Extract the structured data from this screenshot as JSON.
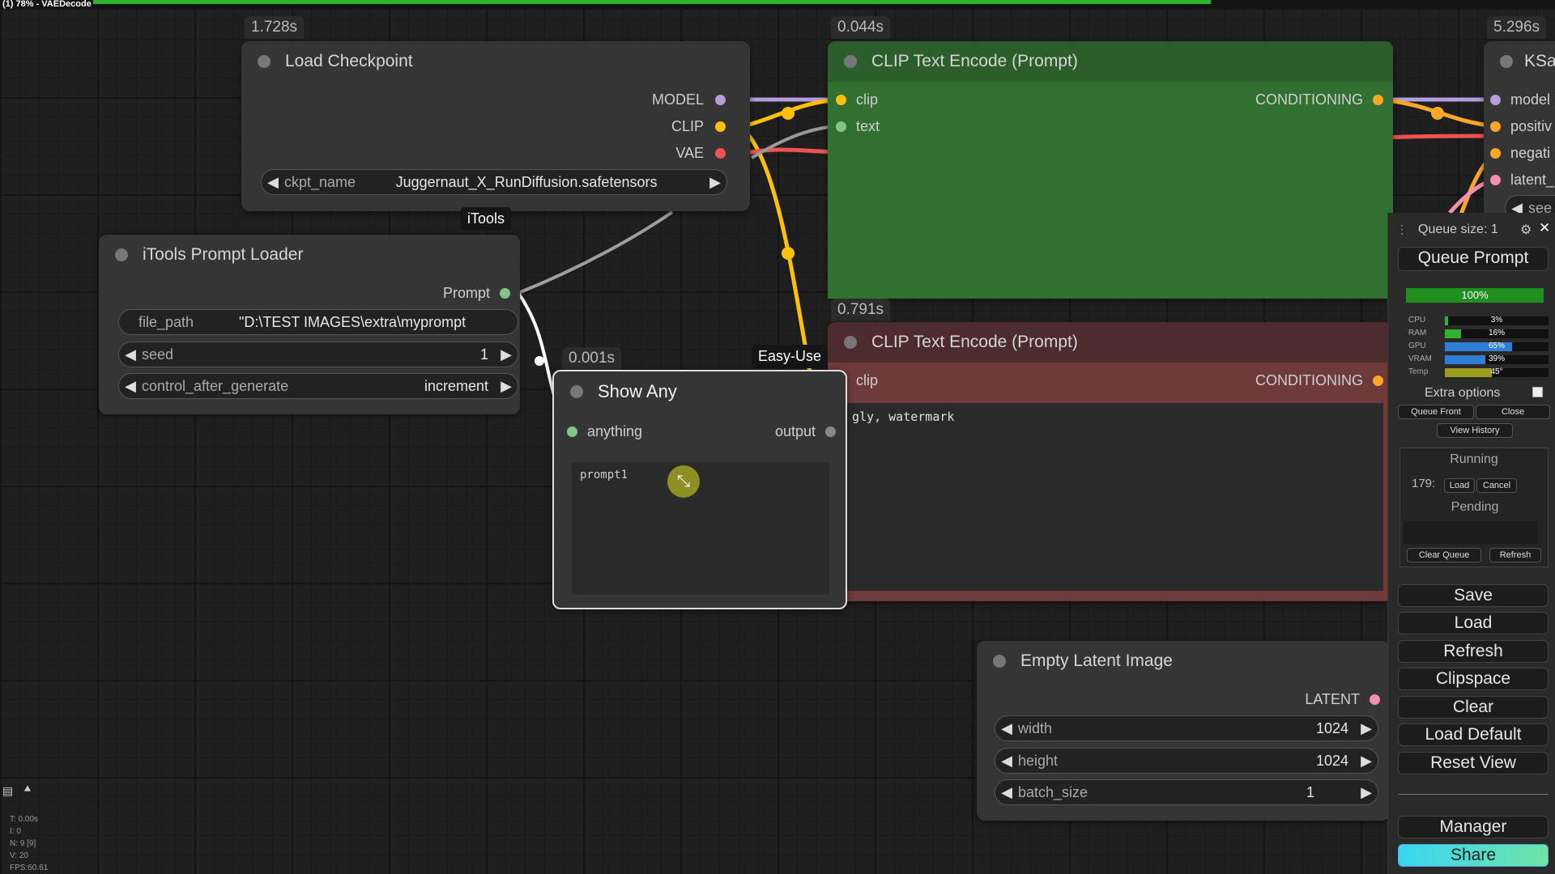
{
  "window": {
    "title": "(1) 78% - VAEDecode"
  },
  "nodes": {
    "load_checkpoint": {
      "timing": "1.728s",
      "title": "Load Checkpoint",
      "outputs": {
        "model": "MODEL",
        "clip": "CLIP",
        "vae": "VAE"
      },
      "ckpt_name_label": "ckpt_name",
      "ckpt_name_value": "Juggernaut_X_RunDiffusion.safetensors"
    },
    "itools": {
      "group_tag": "iTools",
      "title": "iTools Prompt Loader",
      "output_prompt": "Prompt",
      "file_path_label": "file_path",
      "file_path_value": "\"D:\\TEST IMAGES\\extra\\myprompt",
      "seed_label": "seed",
      "seed_value": "1",
      "control_label": "control_after_generate",
      "control_value": "increment"
    },
    "clip_pos": {
      "timing": "0.044s",
      "title": "CLIP Text Encode (Prompt)",
      "input_clip": "clip",
      "input_text": "text",
      "output": "CONDITIONING"
    },
    "clip_neg": {
      "timing": "0.791s",
      "title": "CLIP Text Encode (Prompt)",
      "input_clip": "clip",
      "output": "CONDITIONING",
      "text": "gly, watermark"
    },
    "show_any": {
      "timing": "0.001s",
      "group_tag": "Easy-Use",
      "title": "Show Any",
      "input": "anything",
      "output": "output",
      "content": "prompt1"
    },
    "ksampler": {
      "timing": "5.296s",
      "title": "KSa",
      "inputs": {
        "model": "model",
        "positive": "positiv",
        "negative": "negati",
        "latent": "latent_"
      },
      "widget": "see"
    },
    "empty_latent": {
      "title": "Empty Latent Image",
      "output": "LATENT",
      "width_label": "width",
      "width_value": "1024",
      "height_label": "height",
      "height_value": "1024",
      "batch_label": "batch_size",
      "batch_value": "1"
    }
  },
  "panel": {
    "queue_size": "Queue size: 1",
    "queue_prompt": "Queue Prompt",
    "progress": "100%",
    "stats": [
      {
        "label": "CPU",
        "value": "3%",
        "level": 3,
        "color": "#2fb32f"
      },
      {
        "label": "RAM",
        "value": "16%",
        "level": 16,
        "color": "#2fb32f"
      },
      {
        "label": "GPU",
        "value": "65%",
        "level": 65,
        "color": "#2f7fd6"
      },
      {
        "label": "VRAM",
        "value": "39%",
        "level": 39,
        "color": "#2f7fd6"
      },
      {
        "label": "Temp",
        "value": "45°",
        "level": 45,
        "color": "#9c9c1f"
      }
    ],
    "extra_options": "Extra options",
    "queue_front": "Queue Front",
    "close": "Close",
    "view_history": "View History",
    "running": "Running",
    "running_id": "179:",
    "load": "Load",
    "cancel": "Cancel",
    "pending": "Pending",
    "clear_queue": "Clear Queue",
    "refresh_small": "Refresh",
    "buttons": [
      "Save",
      "Load",
      "Refresh",
      "Clipspace",
      "Clear",
      "Load Default",
      "Reset View"
    ],
    "manager": "Manager",
    "share": "Share"
  },
  "canvas_stats": [
    "T: 0.00s",
    "I: 0",
    "N: 9 [9]",
    "V: 20",
    "FPS:60.61"
  ]
}
